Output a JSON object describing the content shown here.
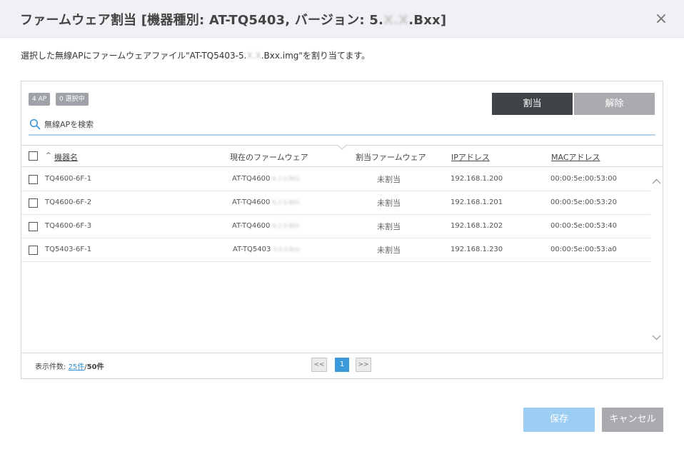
{
  "dialog": {
    "title_prefix": "ファームウェア割当 [機器種別: AT-TQ5403, バージョン: 5.",
    "title_blur": "X.X",
    "title_suffix": ".Bxx]",
    "close_glyph": "×"
  },
  "description": {
    "prefix": "選択した無線APにファームウェアファイル\"AT-TQ5403-5.",
    "blur": "X.X",
    "suffix": ".Bxx.img\"を割り当てます。"
  },
  "badges": {
    "ap_count": "4 AP",
    "selected_count": "0 選択中"
  },
  "actions": {
    "assign_label": "割当",
    "release_label": "解除"
  },
  "search": {
    "placeholder": "無線APを検索",
    "value": ""
  },
  "table": {
    "columns": {
      "sort_caret": "^",
      "device_name": "機器名",
      "current_fw": "現在のファームウェア",
      "assigned_fw": "割当ファームウェア",
      "ip": "IPアドレス",
      "mac": "MACアドレス"
    },
    "rows": [
      {
        "name": "TQ4600-6F-1",
        "fw_model": "AT-TQ4600",
        "fw_ver": "6.2.0.B01",
        "assigned": "未割当",
        "ip": "192.168.1.200",
        "mac": "00:00:5e:00:53:00"
      },
      {
        "name": "TQ4600-6F-2",
        "fw_model": "AT-TQ4600",
        "fw_ver": "6.2.0.B01",
        "assigned": "未割当",
        "ip": "192.168.1.201",
        "mac": "00:00:5e:00:53:20"
      },
      {
        "name": "TQ4600-6F-3",
        "fw_model": "AT-TQ4600",
        "fw_ver": "6.2.0.B01",
        "assigned": "未割当",
        "ip": "192.168.1.202",
        "mac": "00:00:5e:00:53:40"
      },
      {
        "name": "TQ5403-6F-1",
        "fw_model": "AT-TQ5403",
        "fw_ver": "5.0.0.Bxx",
        "assigned": "未割当",
        "ip": "192.168.1.230",
        "mac": "00:00:5e:00:53:a0"
      }
    ]
  },
  "pagination": {
    "label": "表示件数:",
    "per_page": "25件",
    "separator": "/",
    "total": "50件",
    "prev": "<<",
    "current": "1",
    "next": ">>"
  },
  "footer_buttons": {
    "save_label": "保存",
    "cancel_label": "キャンセル"
  },
  "colors": {
    "accent": "#3b9ad9",
    "save_disabled": "#9ccdf2",
    "dark_button": "#414446",
    "gray_button": "#a9abae"
  }
}
